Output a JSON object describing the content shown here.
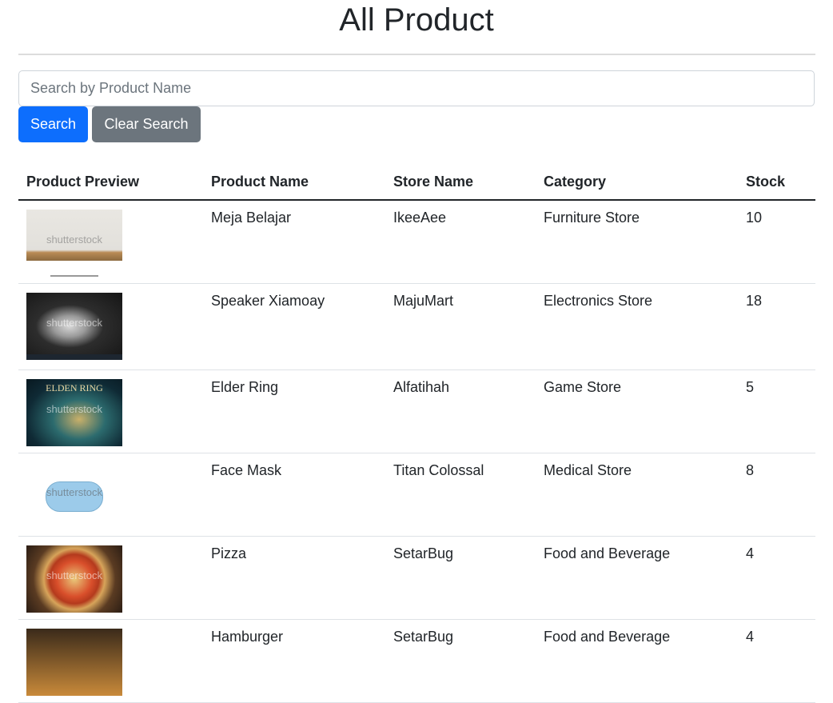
{
  "page": {
    "title": "All Product"
  },
  "search": {
    "placeholder": "Search by Product Name",
    "value": "",
    "search_label": "Search",
    "clear_label": "Clear Search"
  },
  "table": {
    "columns": [
      "Product Preview",
      "Product Name",
      "Store Name",
      "Category",
      "Stock"
    ],
    "rows": [
      {
        "preview": "desk-image",
        "name": "Meja Belajar",
        "store": "IkeeAee",
        "category": "Furniture Store",
        "stock": "10"
      },
      {
        "preview": "speaker-image",
        "name": "Speaker Xiamoay",
        "store": "MajuMart",
        "category": "Electronics Store",
        "stock": "18"
      },
      {
        "preview": "elden-ring-image",
        "name": "Elder Ring",
        "store": "Alfatihah",
        "category": "Game Store",
        "stock": "5"
      },
      {
        "preview": "face-mask-image",
        "name": "Face Mask",
        "store": "Titan Colossal",
        "category": "Medical Store",
        "stock": "8"
      },
      {
        "preview": "pizza-image",
        "name": "Pizza",
        "store": "SetarBug",
        "category": "Food and Beverage",
        "stock": "4"
      },
      {
        "preview": "hamburger-image",
        "name": "Hamburger",
        "store": "SetarBug",
        "category": "Food and Beverage",
        "stock": "4"
      }
    ]
  },
  "image_watermark": "shutterstock",
  "image_logo_text": "ELDEN RING",
  "colors": {
    "primary": "#0d6efd",
    "secondary": "#6c757d",
    "text": "#212529"
  }
}
